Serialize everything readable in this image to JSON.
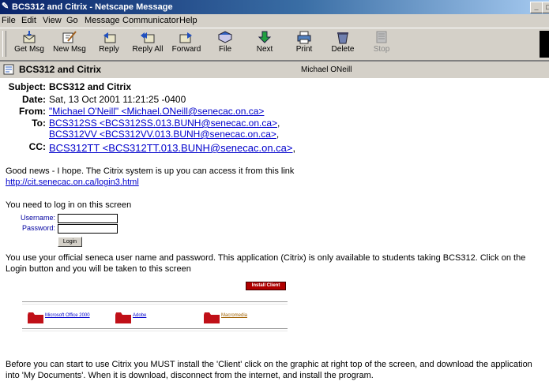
{
  "window": {
    "title": "BCS312 and Citrix - Netscape Message"
  },
  "menu": [
    "File",
    "Edit",
    "View",
    "Go",
    "Message",
    "Communicator",
    "Help"
  ],
  "toolbar": {
    "buttons": [
      {
        "label": "Get Msg",
        "icon": "get-msg-icon"
      },
      {
        "label": "New Msg",
        "icon": "new-msg-icon"
      },
      {
        "label": "Reply",
        "icon": "reply-icon"
      },
      {
        "label": "Reply All",
        "icon": "reply-all-icon"
      },
      {
        "label": "Forward",
        "icon": "forward-icon"
      },
      {
        "label": "File",
        "icon": "file-icon"
      },
      {
        "label": "Next",
        "icon": "next-icon"
      },
      {
        "label": "Print",
        "icon": "print-icon"
      },
      {
        "label": "Delete",
        "icon": "delete-icon"
      },
      {
        "label": "Stop",
        "icon": "stop-icon",
        "disabled": true
      }
    ]
  },
  "strip": {
    "subject": "BCS312 and Citrix",
    "from": "Michael ONeill"
  },
  "headers": {
    "subject_label": "Subject:",
    "subject": "BCS312 and Citrix",
    "date_label": "Date:",
    "date": "Sat, 13 Oct 2001 11:21:25 -0400",
    "from_label": "From:",
    "from": "\"Michael O'Neill\" <Michael.ONeill@senecac.on.ca>",
    "to_label": "To:",
    "to": [
      "BCS312SS <BCS312SS.013.BUNH@senecac.on.ca>",
      "BCS312VV <BCS312VV.013.BUNH@senecac.on.ca>"
    ],
    "cc_label": "CC:",
    "cc": "BCS312TT <BCS312TT.013.BUNH@senecac.on.ca>"
  },
  "body": {
    "intro": "Good news - I hope. The Citrix system is up you can access it from this link",
    "link": "http://cit.senecac.on.ca/login3.html",
    "login_prompt": "You need to log in on this screen",
    "username_label": "Username:",
    "password_label": "Password:",
    "username_value": "",
    "password_value": "",
    "login_button": "Login",
    "paragraph2": "You use your official seneca user name and password. This application (Citrix) is only available to students taking BCS312. Click on the Login button and you will be taken to this screen",
    "install_client": "Install Client",
    "folders": [
      "Microsoft Office 2000",
      "Adobe",
      "Macromedia"
    ],
    "paragraph3": "Before you can start to use Citrix you MUST install the 'Client' click on the graphic at right top of the screen, and download the application into 'My Documents'. When it is download, disconnect from the internet, and install the program."
  },
  "colors": {
    "link": "#0000cc",
    "titlebar": "#0a246a",
    "chrome": "#d4d0c8"
  }
}
